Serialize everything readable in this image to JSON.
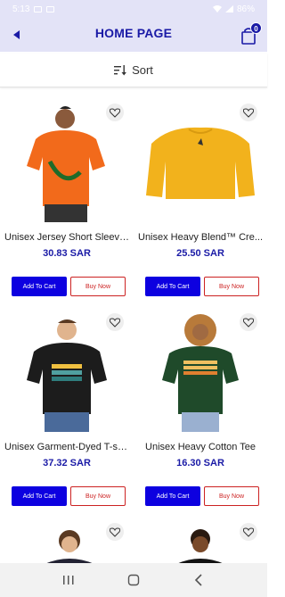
{
  "status": {
    "time": "5:13",
    "battery": "86%"
  },
  "header": {
    "title": "HOME PAGE",
    "cart_count": "0"
  },
  "sort": {
    "label": "Sort"
  },
  "colors": {
    "accent": "#1a1aa6",
    "buy_red": "#cc2222",
    "cart_blue": "#0d00e0"
  },
  "products": [
    {
      "name": "Unisex Jersey Short Sleeve ...",
      "price": "30.83 SAR",
      "add_label": "Add To Cart",
      "buy_label": "Buy Now",
      "image": "orange-tshirt-man"
    },
    {
      "name": "Unisex Heavy Blend™ Cre...",
      "price": "25.50 SAR",
      "add_label": "Add To Cart",
      "buy_label": "Buy Now",
      "image": "yellow-sweatshirt"
    },
    {
      "name": "Unisex Garment-Dyed T-sh...",
      "price": "37.32 SAR",
      "add_label": "Add To Cart",
      "buy_label": "Buy Now",
      "image": "black-tshirt-man"
    },
    {
      "name": "Unisex Heavy Cotton Tee",
      "price": "16.30 SAR",
      "add_label": "Add To Cart",
      "buy_label": "Buy Now",
      "image": "green-tshirt-woman"
    },
    {
      "name": "",
      "price": "",
      "image": "partial-person"
    },
    {
      "name": "",
      "price": "",
      "image": "partial-person"
    }
  ]
}
